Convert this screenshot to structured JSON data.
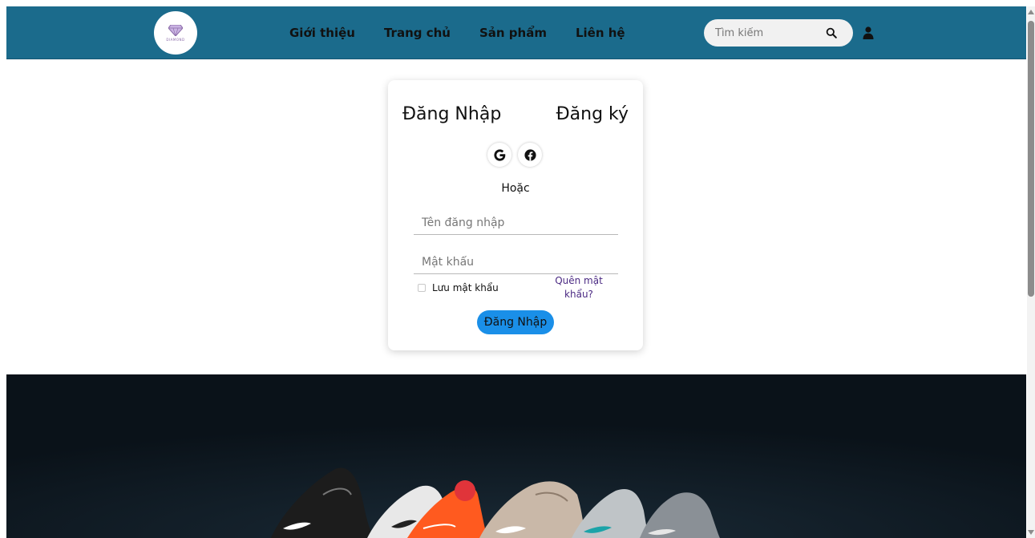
{
  "brand": {
    "logo_text": "DIAMOND"
  },
  "nav": {
    "items": [
      {
        "label": "Giới thiệu"
      },
      {
        "label": "Trang chủ"
      },
      {
        "label": "Sản phẩm"
      },
      {
        "label": "Liên hệ"
      }
    ]
  },
  "search": {
    "placeholder": "Tìm kiếm",
    "icon": "search-icon"
  },
  "header_icons": {
    "user": "user-icon"
  },
  "login": {
    "tab_login": "Đăng Nhập",
    "tab_register": "Đăng ký",
    "social": [
      "google-icon",
      "facebook-icon"
    ],
    "or_text": "Hoặc",
    "username_placeholder": "Tên đăng nhập",
    "password_placeholder": "Mật khẩu",
    "remember_label": "Lưu mật khẩu",
    "forgot_label": "Quên mật khẩu?",
    "submit_label": "Đăng Nhập"
  },
  "colors": {
    "header_bg": "#1b6b8c",
    "submit_bg": "#1a8fe8",
    "link": "#4b2a83",
    "hero_bg": "#0a1219"
  }
}
